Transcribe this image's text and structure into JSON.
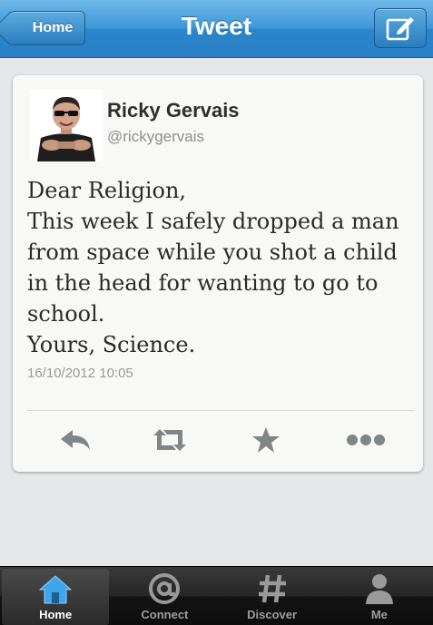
{
  "navbar": {
    "back_label": "Home",
    "title": "Tweet"
  },
  "tweet": {
    "user_name": "Ricky Gervais",
    "user_handle": "@rickygervais",
    "lines": [
      "Dear Religion,",
      "This week I safely dropped a man",
      "from space while you shot a child",
      "in the head for wanting to go to",
      "school.",
      "Yours, Science."
    ],
    "timestamp": "16/10/2012 10:05"
  },
  "actions": [
    "reply-icon",
    "retweet-icon",
    "favorite-icon",
    "more-icon"
  ],
  "tabbar": {
    "tabs": [
      {
        "label": "Home",
        "icon": "home-icon",
        "active": true
      },
      {
        "label": "Connect",
        "icon": "at-icon",
        "active": false
      },
      {
        "label": "Discover",
        "icon": "hashtag-icon",
        "active": false
      },
      {
        "label": "Me",
        "icon": "person-icon",
        "active": false
      }
    ]
  },
  "colors": {
    "nav_blue": "#3e98d8",
    "active_tab_icon": "#3fa4ec",
    "action_icon": "#7f8688"
  }
}
